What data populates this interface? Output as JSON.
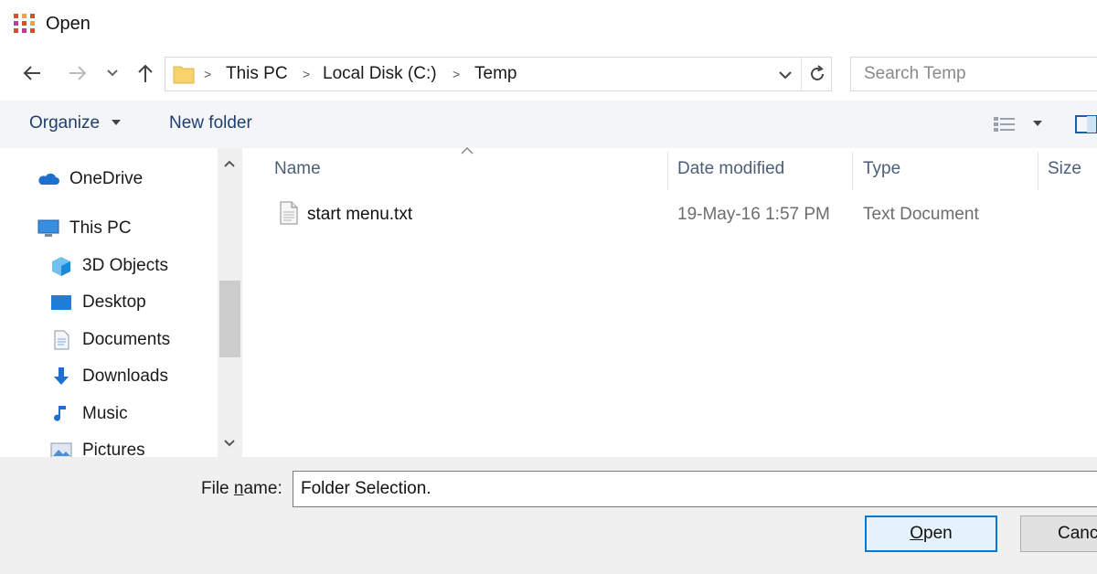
{
  "window": {
    "title": "Open",
    "icon": "app-grid-icon"
  },
  "nav": {
    "back_icon": "arrow-left-icon",
    "forward_icon": "arrow-right-icon",
    "recent_icon": "chevron-down-icon",
    "up_icon": "arrow-up-icon",
    "breadcrumb": [
      "This PC",
      "Local Disk (C:)",
      "Temp"
    ],
    "search_placeholder": "Search Temp"
  },
  "toolbar": {
    "organize_label": "Organize",
    "new_folder_label": "New folder"
  },
  "sidebar": {
    "items": [
      {
        "label": "OneDrive",
        "icon": "cloud-icon"
      },
      {
        "label": "This PC",
        "icon": "monitor-icon"
      },
      {
        "label": "3D Objects",
        "icon": "cube-icon"
      },
      {
        "label": "Desktop",
        "icon": "desktop-icon"
      },
      {
        "label": "Documents",
        "icon": "document-icon"
      },
      {
        "label": "Downloads",
        "icon": "download-arrow-icon"
      },
      {
        "label": "Music",
        "icon": "music-note-icon"
      },
      {
        "label": "Pictures",
        "icon": "pictures-icon"
      }
    ]
  },
  "filelist": {
    "columns": [
      "Name",
      "Date modified",
      "Type",
      "Size"
    ],
    "rows": [
      {
        "name": "start menu.txt",
        "date": "19-May-16 1:57 PM",
        "type": "Text Document",
        "size": ""
      }
    ]
  },
  "footer": {
    "filename_label_pre": "File ",
    "filename_label_ul": "n",
    "filename_label_post": "ame:",
    "filename_value": "Folder Selection.",
    "open_ul": "O",
    "open_rest": "pen",
    "cancel_label": "Cancel"
  },
  "colors": {
    "accent": "#0078d7",
    "folder": "#f8d26a",
    "link_text": "#1f3f6f"
  }
}
